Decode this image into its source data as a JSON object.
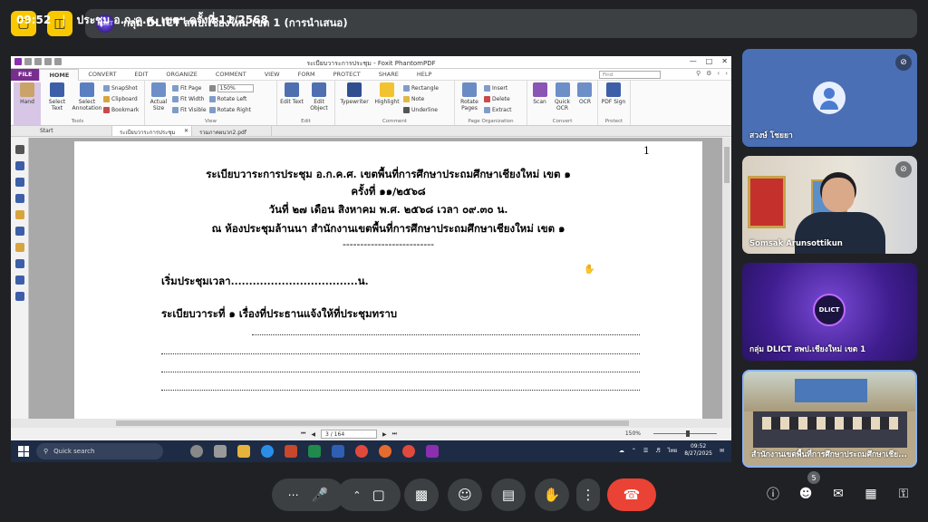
{
  "meet": {
    "title": "กลุ่ม DLICT สพป.เชียงใหม่ เขต 1 (การนำเสนอ)",
    "logo_text": "DLICT",
    "time": "09:52",
    "separator": "|",
    "meeting_name": "ประชุม อ.ก.ค.ศ. เขตฯ ครั้งที่ 11/2568",
    "participants_count": "5"
  },
  "app": {
    "title": "ระเบียบวาระการประชุม - Foxit PhantomPDF",
    "menu_tabs": [
      "FILE",
      "HOME",
      "CONVERT",
      "EDIT",
      "ORGANIZE",
      "COMMENT",
      "VIEW",
      "FORM",
      "PROTECT",
      "SHARE",
      "HELP"
    ],
    "find_placeholder": "Find",
    "ribbon": {
      "hand": "Hand",
      "select_text": "Select Text",
      "select_annotation": "Select Annotation",
      "snapshot": "SnapShot",
      "clipboard": "Clipboard",
      "bookmark": "Bookmark",
      "tools_label": "Tools",
      "actual_size": "Actual Size",
      "fit_page": "Fit Page",
      "fit_width": "Fit Width",
      "fit_visible": "Fit Visible",
      "zoom_value": "150%",
      "rotate_left": "Rotate Left",
      "rotate_right": "Rotate Right",
      "view_label": "View",
      "edit_text": "Edit Text",
      "edit_object": "Edit Object",
      "edit_label": "Edit",
      "typewriter": "Typewriter",
      "highlight": "Highlight",
      "rectangle": "Rectangle",
      "note": "Note",
      "underline": "Underline",
      "comment_label": "Comment",
      "rotate_pages": "Rotate Pages",
      "insert": "Insert",
      "delete": "Delete",
      "extract": "Extract",
      "page_org_label": "Page Organization",
      "scan": "Scan",
      "quick_ocr": "Quick OCR",
      "ocr": "OCR",
      "convert_label": "Convert",
      "pdf_sign": "PDF Sign",
      "protect_label": "Protect"
    },
    "doc_tabs": [
      "Start",
      "ระเบียบวาระการประชุม",
      "รวมภาคผนวก2.pdf"
    ],
    "page_indicator": "3 / 164",
    "zoom_status": "150%"
  },
  "document": {
    "page_number": "1",
    "line1": "ระเบียบวาระการประชุม อ.ก.ค.ศ. เขตพื้นที่การศึกษาประถมศึกษาเชียงใหม่ เขต ๑",
    "line2": "ครั้งที่ ๑๑/๒๕๖๘",
    "line3": "วันที่ ๒๗ เดือน สิงหาคม พ.ศ. ๒๕๖๘ เวลา ๐๙.๓๐ น.",
    "line4": "ณ ห้องประชุมล้านนา สำนักงานเขตพื้นที่การศึกษาประถมศึกษาเชียงใหม่ เขต ๑",
    "divider": "--------------------------",
    "start_time": "เริ่มประชุมเวลา...................................น.",
    "agenda1": "ระเบียบวาระที่ ๑  เรื่องที่ประธานแจ้งให้ที่ประชุมทราบ"
  },
  "taskbar": {
    "search": "Quick search",
    "time": "09:52",
    "date": "8/27/2025",
    "lang": "ไทย"
  },
  "participants": [
    {
      "name": "สวงษ์ โชยยา"
    },
    {
      "name": "Somsak Arunsottikun"
    },
    {
      "name": "กลุ่ม DLICT สพป.เชียงใหม่ เขต 1"
    },
    {
      "name": "สำนักงานเขตพื้นที่การศึกษาประถมศึกษาเชีย..."
    }
  ],
  "colors": {
    "accent_yellow": "#f9c900",
    "leave_red": "#ea4335",
    "foxit_purple": "#7a2d91",
    "bg_dark": "#202124"
  }
}
